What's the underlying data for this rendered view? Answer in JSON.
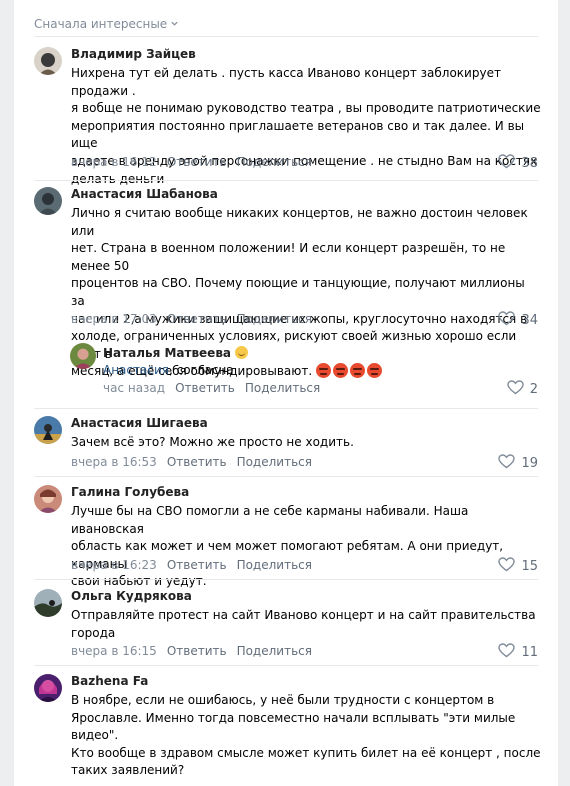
{
  "sort": {
    "label": "Сначала интересные"
  },
  "comments": [
    {
      "author": "Владимир Зайцев",
      "lines": [
        "Нихрена тут ей делать . пусть касса Иваново концерт заблокирует продажи .",
        "я вобще не понимаю руководство театра , вы проводите патриотические",
        "мероприятия постоянно приглашаете ветеранов сво и так далее. И вы ище",
        "здаете в аренду этой персонажки помещение . не стыдно Вам на костях",
        "делать деньги"
      ],
      "time": "вчера в 16:12",
      "reply": "Ответить",
      "share": "Поделиться",
      "likes": "38"
    },
    {
      "author": "Анастасия Шабанова",
      "lines": [
        "Лично я считаю вообще никаких концертов, не важно достоин человек или",
        "нет. Страна в военном положении! И если концерт разрешён, то не менее 50",
        "процентов на СВО. Почему поющие и танцующие, получают миллионы за",
        "час или 2,а мужики защищающие их жопы, круглосуточно находятся в",
        "холоде, ограниченных условиях, рискуют своей жизнью хорошо если 300т в",
        "месяц, а ещё себя обмундировывают."
      ],
      "time": "вчера в 17:03",
      "reply": "Ответить",
      "share": "Поделиться",
      "likes": "34"
    },
    {
      "author": "Наталья Матвеева",
      "mention": "Анастасия",
      "text": ", согласна",
      "time": "час назад",
      "reply": "Ответить",
      "share": "Поделиться",
      "likes": "2"
    },
    {
      "author": "Анастасия Шигаева",
      "lines": [
        "Зачем всё это? Можно же просто не ходить."
      ],
      "time": "вчера в 16:53",
      "reply": "Ответить",
      "share": "Поделиться",
      "likes": "19"
    },
    {
      "author": "Галина Голубева",
      "lines": [
        "Лучше бы на СВО помогли а не себе карманы набивали. Наша ивановская",
        "область как может и чем может помогают ребятам. А они приедут, карманы",
        "свои набьют и уедут."
      ],
      "time": "вчера в 16:23",
      "reply": "Ответить",
      "share": "Поделиться",
      "likes": "15"
    },
    {
      "author": "Ольга Кудрякова",
      "lines": [
        "Отправляйте протест на сайт Иваново концерт и на сайт правительства",
        "города"
      ],
      "time": "вчера в 16:15",
      "reply": "Ответить",
      "share": "Поделиться",
      "likes": "11"
    },
    {
      "author": "Bazhena Fa",
      "lines": [
        "В ноябре, если не ошибаюсь, у неё были трудности с концертом в",
        "Ярославле. Именно тогда повсеместно начали всплывать \"эти милые",
        "видео\".",
        "Кто вообще в здравом смысле может купить билет на её концерт , после",
        "таких заявлений?"
      ]
    }
  ],
  "colors": {
    "link": "#2a5885",
    "meta": "#818c99",
    "action": "#626d7a",
    "divider": "#e7e8ec"
  },
  "icons": [
    "chevron-down-icon",
    "heart-icon",
    "angry-emoji-icon",
    "smile-emoji-icon"
  ]
}
